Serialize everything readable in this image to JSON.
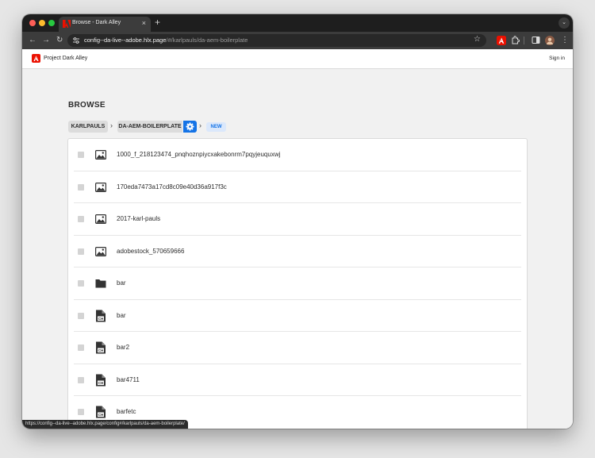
{
  "browser": {
    "tab_title": "Browse - Dark Alley",
    "url_host": "config--da-live--adobe.hlx.page",
    "url_path": "/#/karlpauls/da-aem-boilerplate",
    "status_url": "https://config--da-live--adobe.hlx.page/config#/karlpauls/da-aem-boilerplate/"
  },
  "app": {
    "name": "Project Dark Alley",
    "signin_label": "Sign in"
  },
  "browse": {
    "heading": "BROWSE",
    "breadcrumbs": [
      "KARLPAULS",
      "DA-AEM-BOILERPLATE"
    ],
    "new_label": "NEW"
  },
  "files": [
    {
      "name": "1000_f_218123474_pnqhoznpiycxakebonrm7pqyjeuquxwj",
      "icon": "image-icon"
    },
    {
      "name": "170eda7473a17cd8c09e40d36a917f3c",
      "icon": "image-icon"
    },
    {
      "name": "2017-karl-pauls",
      "icon": "image-icon"
    },
    {
      "name": "adobestock_570659666",
      "icon": "image-icon"
    },
    {
      "name": "bar",
      "icon": "folder-icon"
    },
    {
      "name": "bar",
      "icon": "document-icon"
    },
    {
      "name": "bar2",
      "icon": "document-icon"
    },
    {
      "name": "bar4711",
      "icon": "document-icon"
    },
    {
      "name": "barfetc",
      "icon": "document-icon"
    }
  ],
  "colors": {
    "accent": "#1473e6",
    "adobe_red": "#eb1000"
  }
}
